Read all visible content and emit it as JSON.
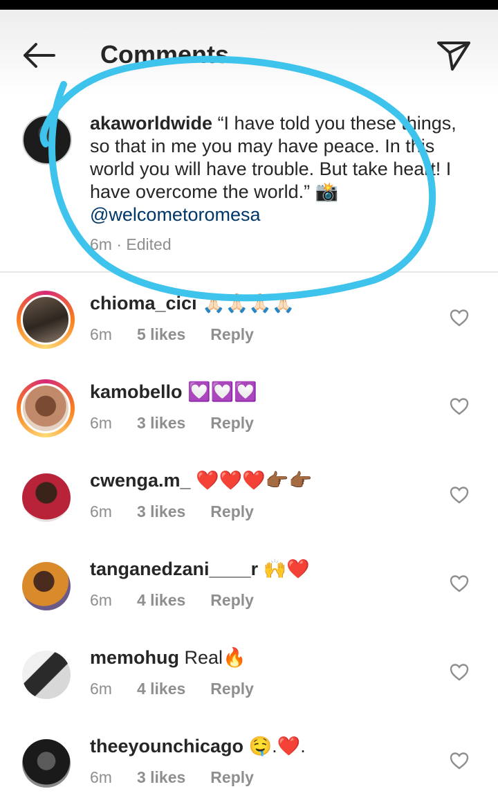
{
  "header": {
    "title": "Comments",
    "back_icon": "back-arrow-icon",
    "send_icon": "paper-plane-icon"
  },
  "caption": {
    "username": "akaworldwide",
    "text": " “I have told you these things, so that in me you may have peace. In this world you will have trouble. But take heart! I have overcome the world.” 📸",
    "mention": "@welcometoromesa",
    "meta": "6m · Edited"
  },
  "comments": [
    {
      "username": "chioma_cici",
      "text": " 🙏🏻🙏🏻🙏🏻🙏🏻",
      "time": "6m",
      "likes": "5 likes",
      "reply": "Reply"
    },
    {
      "username": "kamobello",
      "text": " 💟💟💟",
      "time": "6m",
      "likes": "3 likes",
      "reply": "Reply"
    },
    {
      "username": "cwenga.m_",
      "text": " ❤️❤️❤️👉🏾👉🏾",
      "time": "6m",
      "likes": "3 likes",
      "reply": "Reply"
    },
    {
      "username": "tanganedzani____r",
      "text": " 🙌❤️",
      "time": "6m",
      "likes": "4 likes",
      "reply": "Reply"
    },
    {
      "username": "memohug",
      "text": " Real🔥",
      "time": "6m",
      "likes": "4 likes",
      "reply": "Reply"
    },
    {
      "username": "theeyounchicago",
      "text": " 🤤.❤️.",
      "time": "6m",
      "likes": "3 likes",
      "reply": "Reply"
    }
  ],
  "colors": {
    "text": "#262626",
    "secondary": "#8e8e8e",
    "mention": "#00376b",
    "annotation": "#3ec3ec"
  }
}
